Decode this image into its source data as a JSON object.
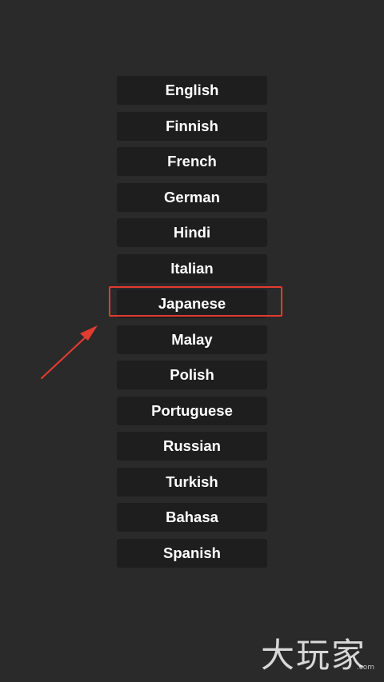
{
  "languages": [
    {
      "label": "English"
    },
    {
      "label": "Finnish"
    },
    {
      "label": "French"
    },
    {
      "label": "German"
    },
    {
      "label": "Hindi"
    },
    {
      "label": "Italian"
    },
    {
      "label": "Japanese"
    },
    {
      "label": "Malay"
    },
    {
      "label": "Polish"
    },
    {
      "label": "Portuguese"
    },
    {
      "label": "Russian"
    },
    {
      "label": "Turkish"
    },
    {
      "label": "Bahasa"
    },
    {
      "label": "Spanish"
    }
  ],
  "annotation": {
    "highlighted_item": "Japanese",
    "color": "#e23b30",
    "arrow_icon": "red-arrow-icon"
  },
  "watermark": {
    "text": "大玩家",
    "sub": ".com"
  },
  "colors": {
    "background": "#2a2a2a",
    "button": "#1e1e1e",
    "text": "#ffffff"
  }
}
